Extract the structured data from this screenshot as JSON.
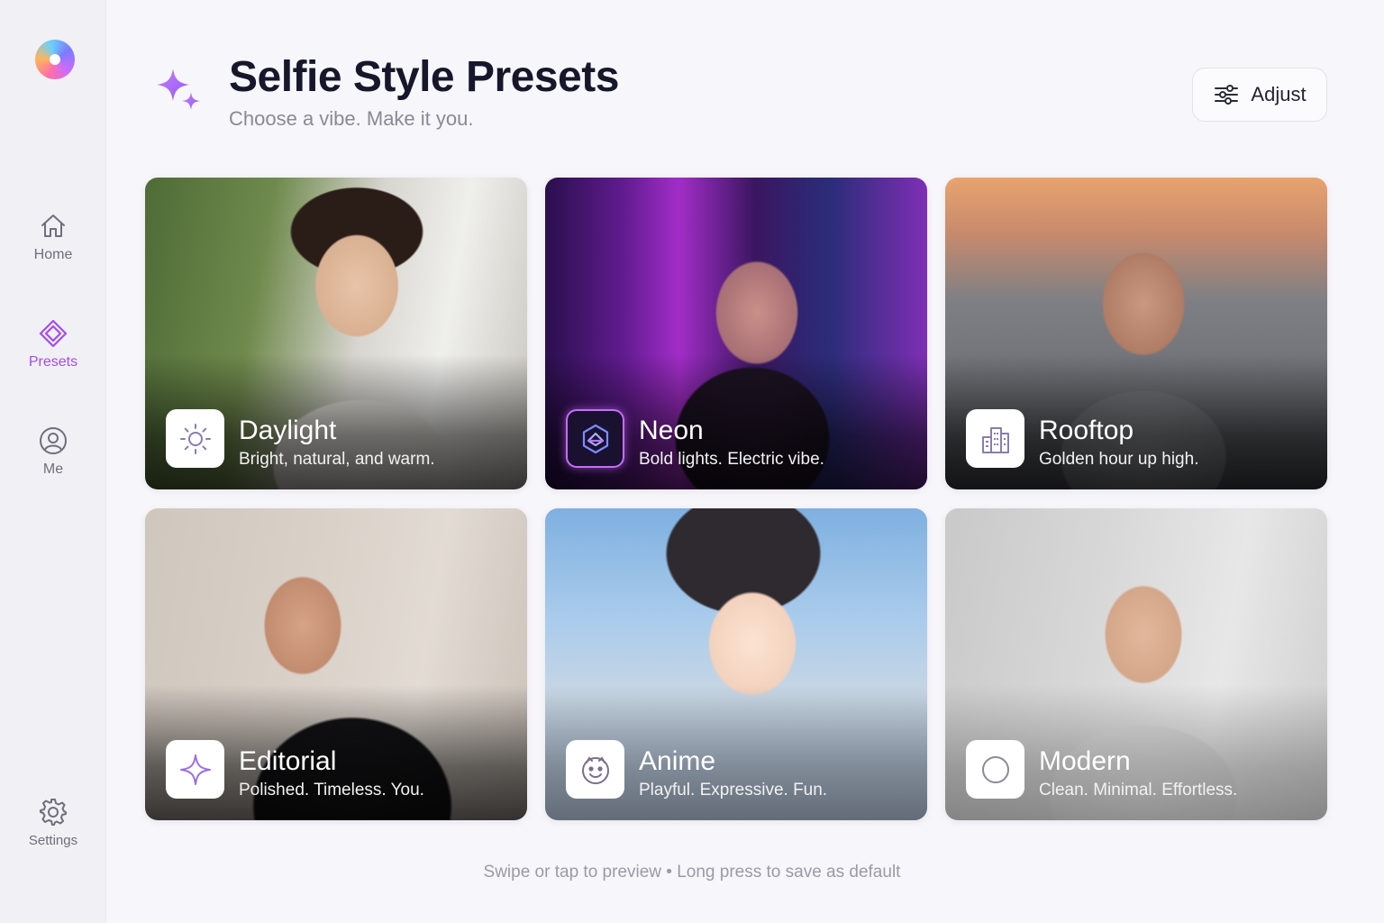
{
  "app": {
    "title": "Selfie Style Presets",
    "subtitle": "Choose a vibe. Make it you.",
    "accent_color": "#a24df0"
  },
  "sidebar": {
    "logo_icon": "app-logo",
    "items": [
      {
        "label": "Home",
        "icon": "home-icon",
        "active": false
      },
      {
        "label": "Presets",
        "icon": "diamond-icon",
        "active": true
      },
      {
        "label": "Me",
        "icon": "user-circle-icon",
        "active": false
      },
      {
        "label": "Settings",
        "icon": "gear-icon",
        "active": false
      }
    ]
  },
  "header": {
    "adjust_label": "Adjust",
    "adjust_icon": "sliders-icon"
  },
  "presets": [
    {
      "title": "Daylight",
      "description": "Bright, natural, and warm.",
      "icon": "sun-icon"
    },
    {
      "title": "Neon",
      "description": "Bold lights. Electric vibe.",
      "icon": "neon-hexagon-icon"
    },
    {
      "title": "Rooftop",
      "description": "Golden hour up high.",
      "icon": "buildings-icon"
    },
    {
      "title": "Editorial",
      "description": "Polished. Timeless. You.",
      "icon": "sparkle-icon"
    },
    {
      "title": "Anime",
      "description": "Playful. Expressive. Fun.",
      "icon": "smiley-face-icon"
    },
    {
      "title": "Modern",
      "description": "Clean. Minimal. Effortless.",
      "icon": "circle-icon"
    }
  ],
  "footer": {
    "hint": "Swipe or tap to preview • Long press to save as default"
  }
}
